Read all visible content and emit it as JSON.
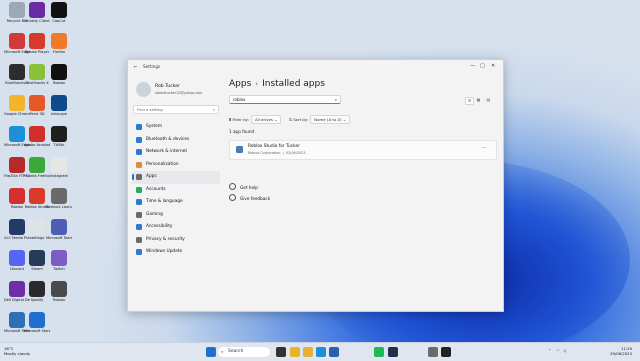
{
  "desktop_icons": [
    {
      "label": "Recycle Bin",
      "color": "#9aa8b8"
    },
    {
      "label": "Microsoft Edge",
      "color": "#d33a3a"
    },
    {
      "label": "BlueStacks X",
      "color": "#2d2d2d"
    },
    {
      "label": "Google Chrome",
      "color": "#f2b42c"
    },
    {
      "label": "Microsoft Edge",
      "color": "#1d8fd6"
    },
    {
      "label": "FileZilla FTP Client",
      "color": "#b52b2b"
    },
    {
      "label": "Roblox",
      "color": "#d62f2f"
    },
    {
      "label": "VLC Media Player",
      "color": "#233a68"
    },
    {
      "label": "Discord",
      "color": "#5865f2"
    },
    {
      "label": "Dell Digital Delivery",
      "color": "#6d2fa8"
    },
    {
      "label": "Microsoft Teams",
      "color": "#2f6fb3"
    },
    {
      "label": "Ghostly Client",
      "color": "#6a2aa3"
    },
    {
      "label": "Roblox Player",
      "color": "#d63a2a"
    },
    {
      "label": "BlueStacks X",
      "color": "#89c23a"
    },
    {
      "label": "Paint 3D",
      "color": "#e3592a"
    },
    {
      "label": "Adobe Acrobat",
      "color": "#d0302a"
    },
    {
      "label": "Mozilla Firefox",
      "color": "#3ba83a"
    },
    {
      "label": "Roblox Studio",
      "color": "#d93a2a"
    },
    {
      "label": "settings",
      "color": "#dfe3e8"
    },
    {
      "label": "Steam",
      "color": "#243b5a"
    },
    {
      "label": "Spotify",
      "color": "#2a2a2a"
    },
    {
      "label": "Microsoft Store",
      "color": "#1f6fd1"
    },
    {
      "label": "CapCut",
      "color": "#111111"
    },
    {
      "label": "Firefox",
      "color": "#f07a2a"
    },
    {
      "label": "Roblox",
      "color": "#111111"
    },
    {
      "label": "Inkscape",
      "color": "#0f4a8a"
    },
    {
      "label": "TikTok",
      "color": "#1f1f1f"
    },
    {
      "label": "Instagram",
      "color": "#e6e6e6"
    },
    {
      "label": "Bedrock Launcher",
      "color": "#6a6a6a"
    },
    {
      "label": "Microsoft Teams",
      "color": "#4d5fb4"
    },
    {
      "label": "Twitch",
      "color": "#7d5cc4"
    },
    {
      "label": "Roblox",
      "color": "#4a4a4a"
    }
  ],
  "window": {
    "title": "Settings",
    "controls": {
      "minimize": "—",
      "maximize": "□",
      "close": "✕"
    }
  },
  "user": {
    "name": "Rob Tucker",
    "email": "roberttucker12@yahoo.com"
  },
  "sidebar": {
    "search_placeholder": "Find a setting",
    "items": [
      {
        "label": "System",
        "color": "#2b7bd1"
      },
      {
        "label": "Bluetooth & devices",
        "color": "#2b7bd1"
      },
      {
        "label": "Network & internet",
        "color": "#2b7bd1"
      },
      {
        "label": "Personalization",
        "color": "#e08a3a"
      },
      {
        "label": "Apps",
        "color": "#6a6a6a",
        "selected": true
      },
      {
        "label": "Accounts",
        "color": "#2bab5a"
      },
      {
        "label": "Time & language",
        "color": "#2b7bd1"
      },
      {
        "label": "Gaming",
        "color": "#6a6a6a"
      },
      {
        "label": "Accessibility",
        "color": "#2b7bd1"
      },
      {
        "label": "Privacy & security",
        "color": "#6a6a6a"
      },
      {
        "label": "Windows Update",
        "color": "#2b7bd1"
      }
    ]
  },
  "main": {
    "breadcrumb": {
      "parent": "Apps",
      "separator": "›",
      "current": "Installed apps"
    },
    "search_value": "roblox",
    "filter": {
      "label": "Filter by:",
      "value": "All drives"
    },
    "sort": {
      "label": "Sort by:",
      "value": "Name (A to Z)"
    },
    "result_count": "1 app found",
    "apps": [
      {
        "name": "Roblox Studio for Tucker",
        "publisher": "Roblox Corporation",
        "date": "02/06/2023"
      }
    ],
    "links": [
      "Get help",
      "Give feedback"
    ]
  },
  "taskbar": {
    "weather_temp": "18°C",
    "weather_desc": "Mostly cloudy",
    "search_label": "Search",
    "time": "11:29",
    "date": "29/06/2023",
    "apps": [
      {
        "name": "start",
        "color": "#1f6fd1"
      },
      {
        "name": "task-view",
        "color": "#333333"
      },
      {
        "name": "chrome",
        "color": "#e8b32a"
      },
      {
        "name": "file-explorer",
        "color": "#e3b03a"
      },
      {
        "name": "edge",
        "color": "#1d8fd6"
      },
      {
        "name": "store",
        "color": "#2a5fb0"
      },
      {
        "name": "spotify",
        "color": "#1db954"
      },
      {
        "name": "steam",
        "color": "#1d2f4a"
      },
      {
        "name": "settings",
        "color": "#6a6a6a"
      },
      {
        "name": "roblox",
        "color": "#222222"
      }
    ]
  }
}
